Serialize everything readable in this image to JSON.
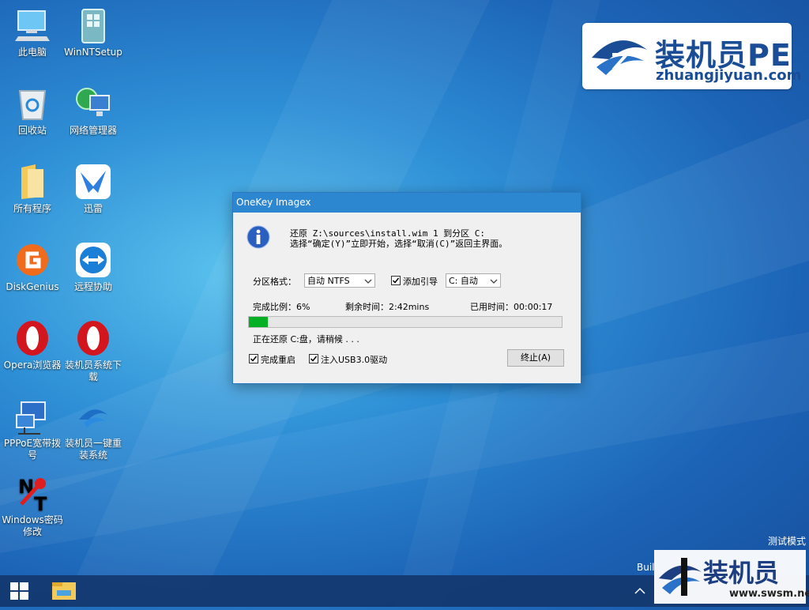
{
  "desktop": {
    "icons": [
      {
        "label": "此电脑",
        "icon": "computer-icon"
      },
      {
        "label": "WinNTSetup",
        "icon": "setup-icon"
      },
      {
        "label": "回收站",
        "icon": "recycle-bin-icon"
      },
      {
        "label": "网络管理器",
        "icon": "network-manager-icon"
      },
      {
        "label": "所有程序",
        "icon": "folder-icon"
      },
      {
        "label": "迅雷",
        "icon": "xunlei-icon"
      },
      {
        "label": "DiskGenius",
        "icon": "diskgenius-icon"
      },
      {
        "label": "远程协助",
        "icon": "teamviewer-icon"
      },
      {
        "label": "Opera浏览器",
        "icon": "opera-icon"
      },
      {
        "label": "装机员系统下载",
        "icon": "opera-icon"
      },
      {
        "label": "PPPoE宽带拨号",
        "icon": "network-dialup-icon"
      },
      {
        "label": "装机员一键重装系统",
        "icon": "zhuangjiyuan-icon"
      },
      {
        "label": "Windows密码修改",
        "icon": "nt-password-icon"
      }
    ]
  },
  "logo": {
    "brand": "装机员PE",
    "url": "zhuangjiyuan.com"
  },
  "dialog": {
    "title": "OneKey Imagex",
    "message_line1": "还原 Z:\\sources\\install.wim 1 到分区 C:",
    "message_line2": "选择“确定(Y)”立即开始，选择“取消(C)”返回主界面。",
    "partition_format_label": "分区格式：",
    "partition_format_value": "自动 NTFS",
    "add_boot_label": "添加引导",
    "add_boot_checked": true,
    "boot_target_value": "C: 自动",
    "progress_label": "完成比例：",
    "progress_text": "6%",
    "progress_percent": 6,
    "remaining_label": "剩余时间：",
    "remaining_value": "2:42mins",
    "elapsed_label": "已用时间：",
    "elapsed_value": "00:00:17",
    "status_text": "正在还原 C:盘，请稍候 . . .",
    "reboot_label": "完成重启",
    "reboot_checked": true,
    "usb3_label": "注入USB3.0驱动",
    "usb3_checked": true,
    "stop_button": "终止(A)"
  },
  "system": {
    "test_mode": "测试模式",
    "build": "Buil"
  },
  "watermark": {
    "text1": "装机员",
    "text2": "www.swsm.net"
  },
  "colors": {
    "titlebar": "#2d86d0",
    "progress": "#06b025",
    "desktop": "#2e8fd6"
  }
}
